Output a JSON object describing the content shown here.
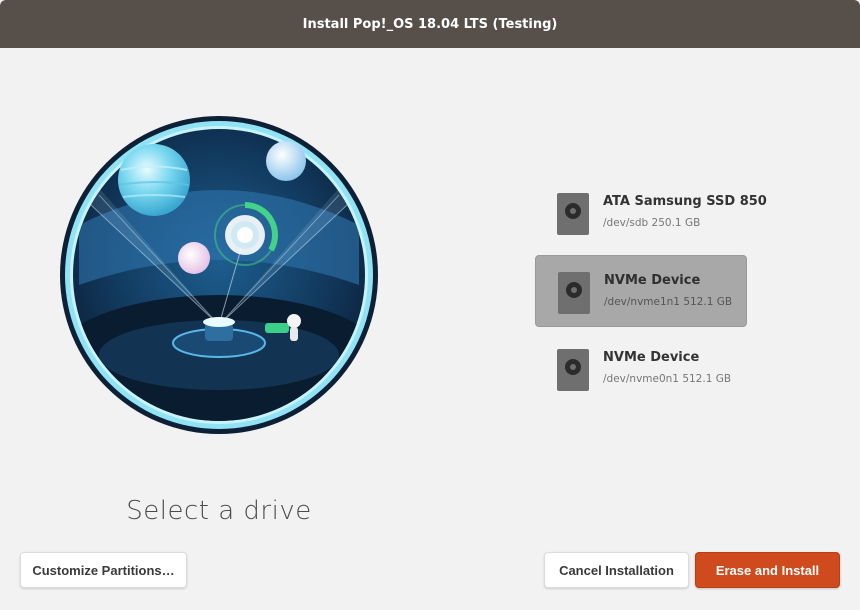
{
  "window": {
    "title": "Install Pop!_OS 18.04 LTS (Testing)"
  },
  "main": {
    "heading": "Select a drive"
  },
  "drives": [
    {
      "name": "ATA Samsung SSD 850",
      "path": "/dev/sdb 250.1 GB",
      "selected": false,
      "icon": "hard-disk-icon"
    },
    {
      "name": "NVMe Device",
      "path": "/dev/nvme1n1 512.1 GB",
      "selected": true,
      "icon": "hard-disk-icon"
    },
    {
      "name": "NVMe Device",
      "path": "/dev/nvme0n1 512.1 GB",
      "selected": false,
      "icon": "hard-disk-icon"
    }
  ],
  "buttons": {
    "customize": "Customize Partitions…",
    "cancel": "Cancel Installation",
    "install": "Erase and Install"
  },
  "colors": {
    "titlebar": "#574f4a",
    "accent": "#cf4a1d",
    "selected_row": "#a8a8a8",
    "background": "#f2f2f2"
  }
}
